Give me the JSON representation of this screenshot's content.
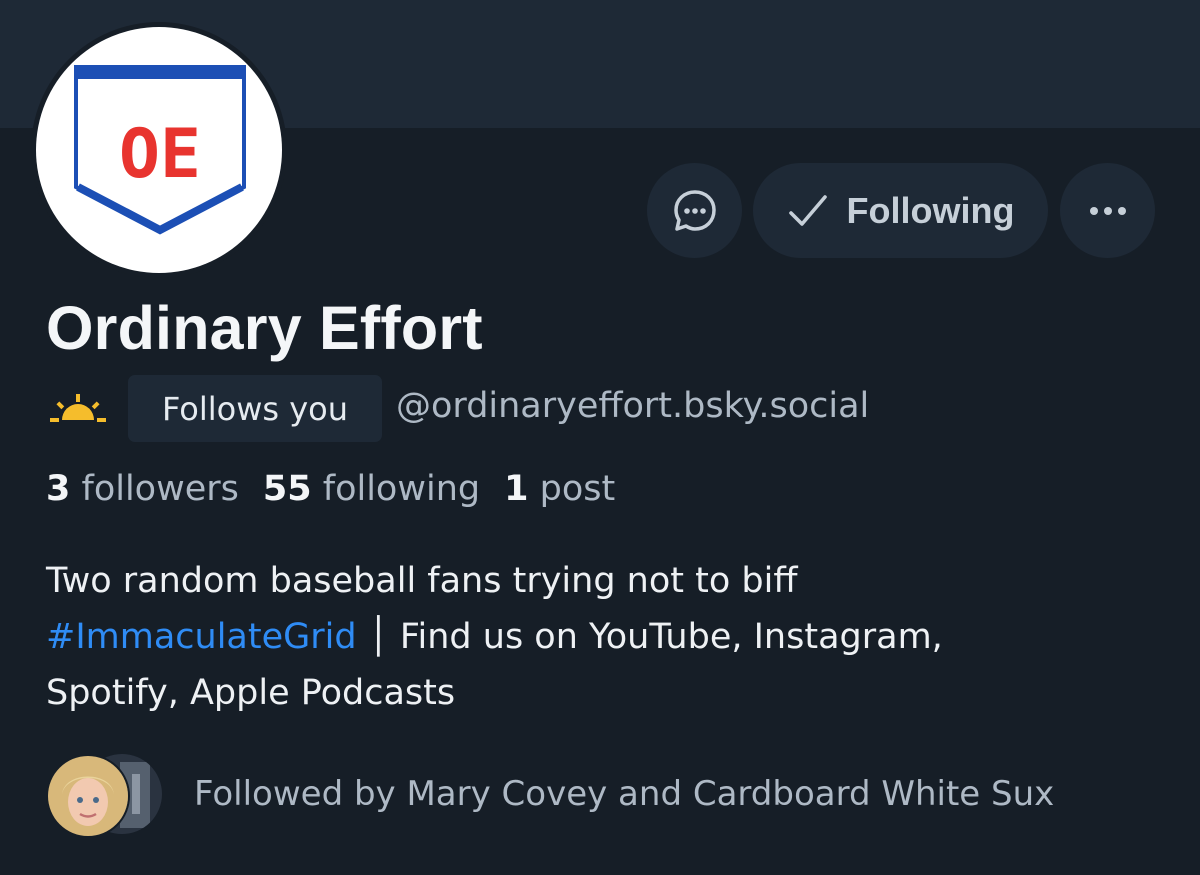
{
  "profile": {
    "display_name": "Ordinary Effort",
    "handle": "@ordinaryeffort.bsky.social",
    "avatar_initials": "OE",
    "follows_you_label": "Follows you",
    "bio_line1": "Two random baseball fans trying not to biff",
    "bio_hashtag": "#ImmaculateGrid",
    "bio_line2_rest": "│ Find us on YouTube, Instagram,",
    "bio_line3": "Spotify, Apple Podcasts",
    "followed_by_text": "Followed by Mary Covey and Cardboard White Sux"
  },
  "stats": {
    "followers_count": "3",
    "followers_label": "followers",
    "following_count": "55",
    "following_label": "following",
    "posts_count": "1",
    "posts_label": "post"
  },
  "actions": {
    "following_label": "Following"
  },
  "icons": {
    "message": "chat-bubble-icon",
    "check": "check-icon",
    "more": "more-dots-icon",
    "sun": "sunrise-icon"
  },
  "colors": {
    "background": "#161e27",
    "banner": "#1e2936",
    "link": "#2f8cf5",
    "logo_blue": "#1c4fb5",
    "logo_red": "#e8342f"
  }
}
